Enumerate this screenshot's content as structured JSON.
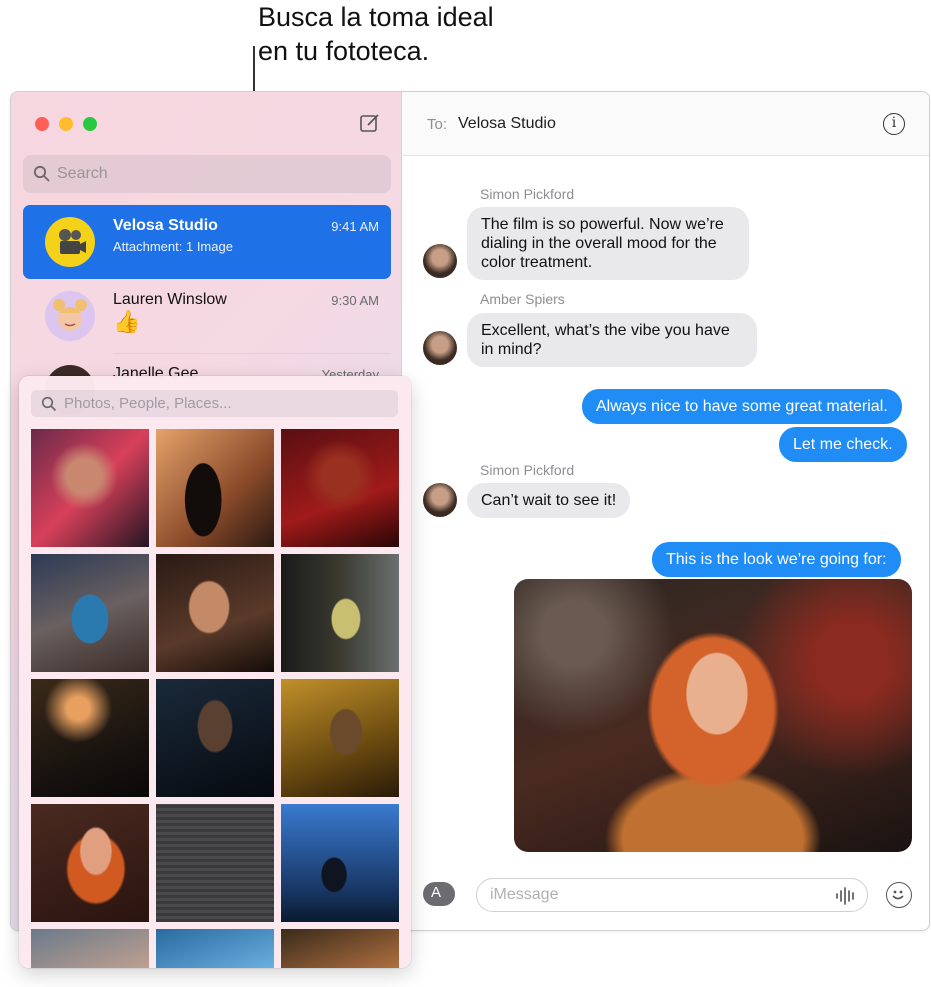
{
  "callout": {
    "line1": "Busca la toma ideal",
    "line2": "en tu fototeca."
  },
  "sidebar": {
    "search_placeholder": "Search",
    "conversations": [
      {
        "name": "Velosa Studio",
        "subtitle": "Attachment: 1 Image",
        "time": "9:41 AM"
      },
      {
        "name": "Lauren Winslow",
        "subtitle": "👍",
        "time": "9:30 AM"
      },
      {
        "name": "Janelle Gee",
        "subtitle": "",
        "time": "Yesterday"
      }
    ]
  },
  "header": {
    "to_label": "To:",
    "recipient": "Velosa Studio"
  },
  "messages": [
    {
      "sender": "Simon Pickford",
      "text": "The film is so powerful. Now we’re dialing in the overall mood for the color treatment."
    },
    {
      "sender": "Amber Spiers",
      "text": "Excellent, what’s the vibe you have in mind?"
    },
    {
      "text": "Always nice to have some great material."
    },
    {
      "text": "Let me check."
    },
    {
      "sender": "Simon Pickford",
      "text": "Can’t wait to see it!"
    },
    {
      "text": "This is the look we’re going for:"
    }
  ],
  "composer": {
    "placeholder": "iMessage"
  },
  "photos_picker": {
    "search_placeholder": "Photos, People, Places..."
  },
  "colors": {
    "accent": "#1f71e8",
    "bubble_blue": "#1f8df5",
    "bubble_gray": "#e9e9eb"
  },
  "icons": [
    "compose-icon",
    "search-icon",
    "info-icon",
    "app-store-icon",
    "waveform-icon",
    "emoji-icon"
  ]
}
